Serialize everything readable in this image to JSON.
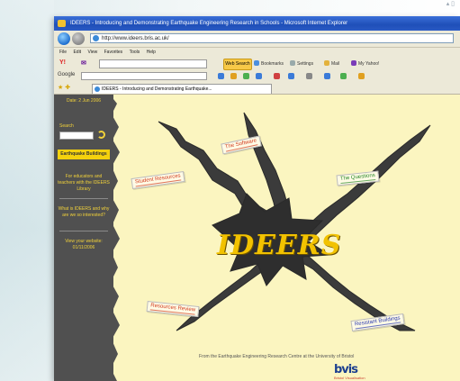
{
  "browser": {
    "title": "IDEERS - Introducing and Demonstrating Earthquake Engineering Research in Schools - Microsoft Internet Explorer",
    "address": "http://www.ideers.bris.ac.uk/",
    "menu": [
      "File",
      "Edit",
      "View",
      "Favorites",
      "Tools",
      "Help"
    ],
    "toolbar": {
      "yahoo_label": "Y!",
      "search_button": "Web Search",
      "bookmarks": "Bookmarks",
      "settings": "Settings",
      "mail": "Mail",
      "my_yahoo": "My Yahoo!"
    },
    "google_label": "Google",
    "tab_title": "IDEERS - Introducing and Demonstrating Earthquake..."
  },
  "sidebar": {
    "date": "Date: 2 Jun 2006",
    "search_label": "Search",
    "button": "Earthquake Buildings",
    "links": [
      "For educators and teachers with the IDEERS Library",
      "What is IDEERS and why are we so interested?",
      "View your website: 01/11/2006"
    ]
  },
  "diagram": {
    "center_title": "IDEERS",
    "labels": {
      "software": "The Software",
      "guide": "Student Resources",
      "answers": "The Questions",
      "resources": "Resources Review",
      "resistant": "Resistant Buildings"
    },
    "footer": "From the Earthquake Engineering Research Centre at the University of Bristol",
    "logo_brand": "bvis",
    "logo_sub": "Bristol Visualisation"
  },
  "colors": {
    "page_bg": "#fbf5c0",
    "sidebar_bg": "#505050",
    "accent_yellow": "#f4d10d",
    "title_blue": "#1f4fb8"
  }
}
